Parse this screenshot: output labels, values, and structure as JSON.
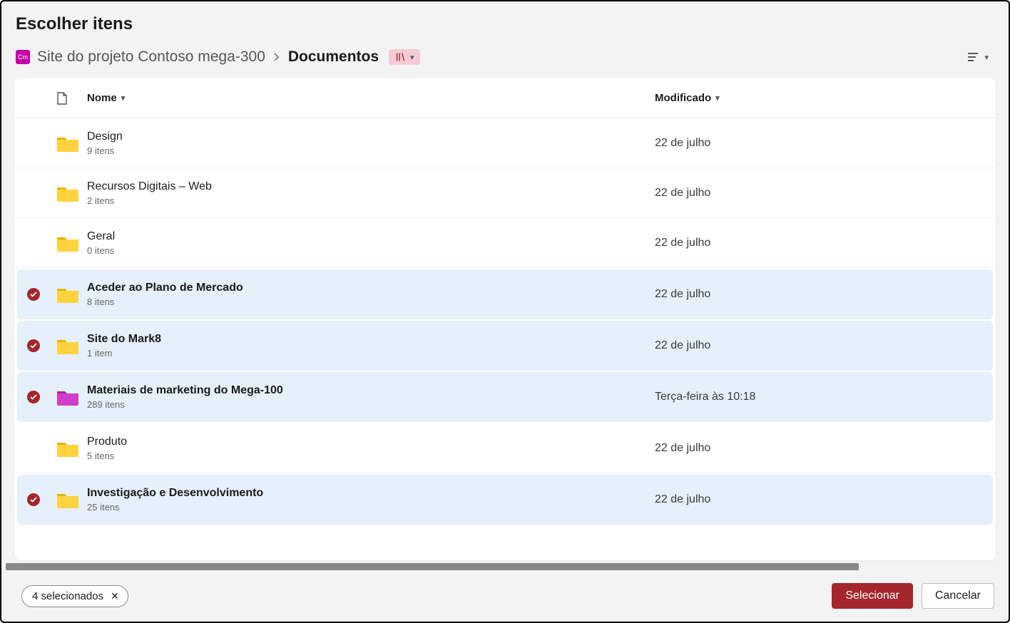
{
  "dialog_title": "Escolher itens",
  "breadcrumb": {
    "site_badge_text": "Cm",
    "site_name": "Site do projeto Contoso mega-300",
    "current": "Documentos"
  },
  "columns": {
    "name": "Nome",
    "modified": "Modificado"
  },
  "items": [
    {
      "name": "Design",
      "sub": "9 itens",
      "modified": "22 de julho",
      "color": "yellow",
      "selected": false
    },
    {
      "name": "Recursos Digitais – Web",
      "sub": "2 itens",
      "modified": "22 de julho",
      "color": "yellow",
      "selected": false
    },
    {
      "name": "Geral",
      "sub": "0 itens",
      "modified": "22 de julho",
      "color": "yellow",
      "selected": false
    },
    {
      "name": "Aceder ao Plano de Mercado",
      "sub": "8 itens",
      "modified": "22 de julho",
      "color": "yellow",
      "selected": true
    },
    {
      "name": "Site do Mark8",
      "sub": "1 item",
      "modified": "22 de julho",
      "color": "yellow",
      "selected": true
    },
    {
      "name": "Materiais de marketing do Mega-100",
      "sub": "289 itens",
      "modified": "Terça-feira às 10:18",
      "color": "magenta",
      "selected": true
    },
    {
      "name": "Produto",
      "sub": "5 itens",
      "modified": "22 de julho",
      "color": "yellow",
      "selected": false
    },
    {
      "name": "Investigação e Desenvolvimento",
      "sub": "25 itens",
      "modified": "22 de julho",
      "color": "yellow",
      "selected": true
    }
  ],
  "footer": {
    "selection_text": "4 selecionados",
    "primary": "Selecionar",
    "secondary": "Cancelar"
  },
  "icons": {
    "folder_yellow": {
      "body": "#ffd23e",
      "tab": "#e8b400"
    },
    "folder_magenta": {
      "body": "#d03fc7",
      "tab": "#b01fa7"
    }
  }
}
